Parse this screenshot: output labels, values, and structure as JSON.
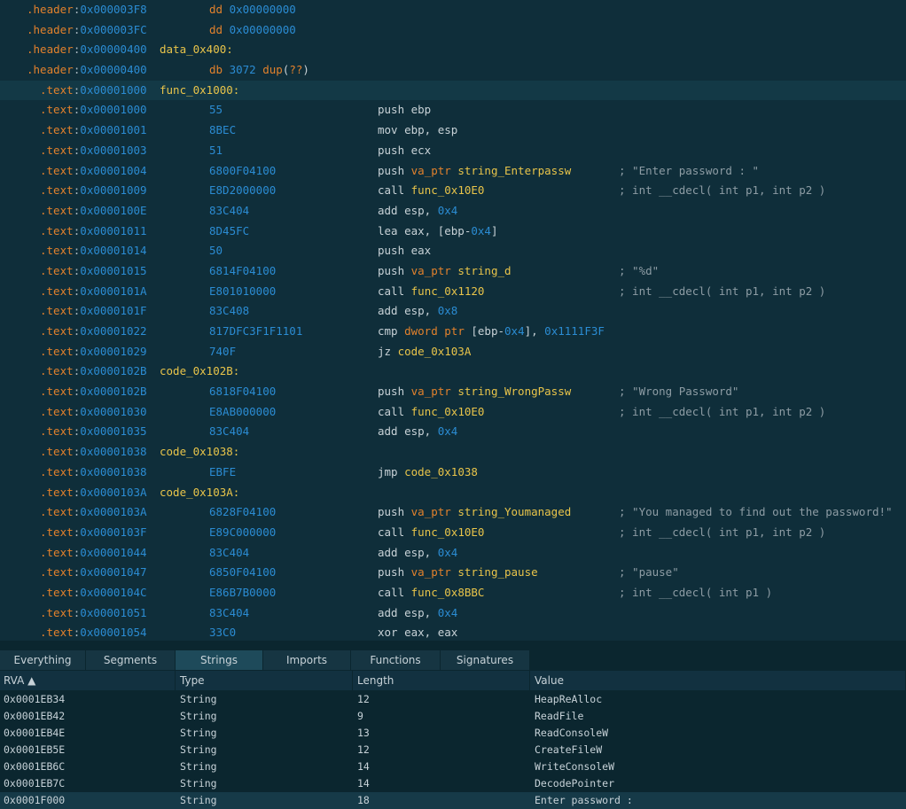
{
  "disassembly": [
    {
      "seg": ".header",
      "addr": "0x000003F8",
      "label": "",
      "bytes": "",
      "parts": [
        [
          "kw",
          "dd "
        ],
        [
          "num",
          "0x00000000"
        ]
      ],
      "comment": "",
      "indent": 0
    },
    {
      "seg": ".header",
      "addr": "0x000003FC",
      "label": "",
      "bytes": "",
      "parts": [
        [
          "kw",
          "dd "
        ],
        [
          "num",
          "0x00000000"
        ]
      ],
      "comment": "",
      "indent": 0
    },
    {
      "seg": ".header",
      "addr": "0x00000400",
      "label": "data_0x400:",
      "bytes": "",
      "parts": [],
      "comment": "",
      "indent": 0
    },
    {
      "seg": ".header",
      "addr": "0x00000400",
      "label": "",
      "bytes": "",
      "parts": [
        [
          "kw",
          "db "
        ],
        [
          "num",
          "3072 "
        ],
        [
          "kw",
          "dup"
        ],
        [
          "op",
          "("
        ],
        [
          "kw",
          "??"
        ],
        [
          "op",
          ")"
        ]
      ],
      "comment": "",
      "indent": 0
    },
    {
      "seg": ".text",
      "addr": "0x00001000",
      "label": "func_0x1000:",
      "bytes": "",
      "parts": [],
      "comment": "",
      "indent": 1,
      "highlight": true
    },
    {
      "seg": ".text",
      "addr": "0x00001000",
      "label": "",
      "bytes": "55",
      "parts": [
        [
          "op",
          "push ebp"
        ]
      ],
      "comment": "",
      "indent": 1
    },
    {
      "seg": ".text",
      "addr": "0x00001001",
      "label": "",
      "bytes": "8BEC",
      "parts": [
        [
          "op",
          "mov ebp, esp"
        ]
      ],
      "comment": "",
      "indent": 1
    },
    {
      "seg": ".text",
      "addr": "0x00001003",
      "label": "",
      "bytes": "51",
      "parts": [
        [
          "op",
          "push ecx"
        ]
      ],
      "comment": "",
      "indent": 1
    },
    {
      "seg": ".text",
      "addr": "0x00001004",
      "label": "",
      "bytes": "6800F04100",
      "parts": [
        [
          "op",
          "push "
        ],
        [
          "kw",
          "va_ptr "
        ],
        [
          "lbl",
          "string_Enterpassw"
        ]
      ],
      "comment": "; \"Enter password : \"",
      "indent": 1
    },
    {
      "seg": ".text",
      "addr": "0x00001009",
      "label": "",
      "bytes": "E8D2000000",
      "parts": [
        [
          "op",
          "call "
        ],
        [
          "lbl",
          "func_0x10E0"
        ]
      ],
      "comment": "; int __cdecl( int p1, int p2 )",
      "indent": 1
    },
    {
      "seg": ".text",
      "addr": "0x0000100E",
      "label": "",
      "bytes": "83C404",
      "parts": [
        [
          "op",
          "add esp, "
        ],
        [
          "num",
          "0x4"
        ]
      ],
      "comment": "",
      "indent": 1
    },
    {
      "seg": ".text",
      "addr": "0x00001011",
      "label": "",
      "bytes": "8D45FC",
      "parts": [
        [
          "op",
          "lea eax, [ebp-"
        ],
        [
          "num",
          "0x4"
        ],
        [
          "op",
          "]"
        ]
      ],
      "comment": "",
      "indent": 1
    },
    {
      "seg": ".text",
      "addr": "0x00001014",
      "label": "",
      "bytes": "50",
      "parts": [
        [
          "op",
          "push eax"
        ]
      ],
      "comment": "",
      "indent": 1
    },
    {
      "seg": ".text",
      "addr": "0x00001015",
      "label": "",
      "bytes": "6814F04100",
      "parts": [
        [
          "op",
          "push "
        ],
        [
          "kw",
          "va_ptr "
        ],
        [
          "lbl",
          "string_d"
        ]
      ],
      "comment": "; \"%d\"",
      "indent": 1
    },
    {
      "seg": ".text",
      "addr": "0x0000101A",
      "label": "",
      "bytes": "E801010000",
      "parts": [
        [
          "op",
          "call "
        ],
        [
          "lbl",
          "func_0x1120"
        ]
      ],
      "comment": "; int __cdecl( int p1, int p2 )",
      "indent": 1
    },
    {
      "seg": ".text",
      "addr": "0x0000101F",
      "label": "",
      "bytes": "83C408",
      "parts": [
        [
          "op",
          "add esp, "
        ],
        [
          "num",
          "0x8"
        ]
      ],
      "comment": "",
      "indent": 1
    },
    {
      "seg": ".text",
      "addr": "0x00001022",
      "label": "",
      "bytes": "817DFC3F1F1101",
      "parts": [
        [
          "op",
          "cmp "
        ],
        [
          "kw",
          "dword ptr "
        ],
        [
          "op",
          "[ebp-"
        ],
        [
          "num",
          "0x4"
        ],
        [
          "op",
          "], "
        ],
        [
          "num",
          "0x1111F3F"
        ]
      ],
      "comment": "",
      "indent": 1
    },
    {
      "seg": ".text",
      "addr": "0x00001029",
      "label": "",
      "bytes": "740F",
      "parts": [
        [
          "op",
          "jz "
        ],
        [
          "lbl",
          "code_0x103A"
        ]
      ],
      "comment": "",
      "indent": 1
    },
    {
      "seg": ".text",
      "addr": "0x0000102B",
      "label": "code_0x102B:",
      "bytes": "",
      "parts": [],
      "comment": "",
      "indent": 1
    },
    {
      "seg": ".text",
      "addr": "0x0000102B",
      "label": "",
      "bytes": "6818F04100",
      "parts": [
        [
          "op",
          "push "
        ],
        [
          "kw",
          "va_ptr "
        ],
        [
          "lbl",
          "string_WrongPassw"
        ]
      ],
      "comment": "; \"Wrong Password\"",
      "indent": 1
    },
    {
      "seg": ".text",
      "addr": "0x00001030",
      "label": "",
      "bytes": "E8AB000000",
      "parts": [
        [
          "op",
          "call "
        ],
        [
          "lbl",
          "func_0x10E0"
        ]
      ],
      "comment": "; int __cdecl( int p1, int p2 )",
      "indent": 1
    },
    {
      "seg": ".text",
      "addr": "0x00001035",
      "label": "",
      "bytes": "83C404",
      "parts": [
        [
          "op",
          "add esp, "
        ],
        [
          "num",
          "0x4"
        ]
      ],
      "comment": "",
      "indent": 1
    },
    {
      "seg": ".text",
      "addr": "0x00001038",
      "label": "code_0x1038:",
      "bytes": "",
      "parts": [],
      "comment": "",
      "indent": 1
    },
    {
      "seg": ".text",
      "addr": "0x00001038",
      "label": "",
      "bytes": "EBFE",
      "parts": [
        [
          "op",
          "jmp "
        ],
        [
          "lbl",
          "code_0x1038"
        ]
      ],
      "comment": "",
      "indent": 1
    },
    {
      "seg": ".text",
      "addr": "0x0000103A",
      "label": "code_0x103A:",
      "bytes": "",
      "parts": [],
      "comment": "",
      "indent": 1
    },
    {
      "seg": ".text",
      "addr": "0x0000103A",
      "label": "",
      "bytes": "6828F04100",
      "parts": [
        [
          "op",
          "push "
        ],
        [
          "kw",
          "va_ptr "
        ],
        [
          "lbl",
          "string_Youmanaged"
        ]
      ],
      "comment": "; \"You managed to find out the password!\"",
      "indent": 1
    },
    {
      "seg": ".text",
      "addr": "0x0000103F",
      "label": "",
      "bytes": "E89C000000",
      "parts": [
        [
          "op",
          "call "
        ],
        [
          "lbl",
          "func_0x10E0"
        ]
      ],
      "comment": "; int __cdecl( int p1, int p2 )",
      "indent": 1
    },
    {
      "seg": ".text",
      "addr": "0x00001044",
      "label": "",
      "bytes": "83C404",
      "parts": [
        [
          "op",
          "add esp, "
        ],
        [
          "num",
          "0x4"
        ]
      ],
      "comment": "",
      "indent": 1
    },
    {
      "seg": ".text",
      "addr": "0x00001047",
      "label": "",
      "bytes": "6850F04100",
      "parts": [
        [
          "op",
          "push "
        ],
        [
          "kw",
          "va_ptr "
        ],
        [
          "lbl",
          "string_pause"
        ]
      ],
      "comment": "; \"pause\"",
      "indent": 1
    },
    {
      "seg": ".text",
      "addr": "0x0000104C",
      "label": "",
      "bytes": "E86B7B0000",
      "parts": [
        [
          "op",
          "call "
        ],
        [
          "lbl",
          "func_0x8BBC"
        ]
      ],
      "comment": "; int __cdecl( int p1 )",
      "indent": 1
    },
    {
      "seg": ".text",
      "addr": "0x00001051",
      "label": "",
      "bytes": "83C404",
      "parts": [
        [
          "op",
          "add esp, "
        ],
        [
          "num",
          "0x4"
        ]
      ],
      "comment": "",
      "indent": 1
    },
    {
      "seg": ".text",
      "addr": "0x00001054",
      "label": "",
      "bytes": "33C0",
      "parts": [
        [
          "op",
          "xor eax, eax"
        ]
      ],
      "comment": "",
      "indent": 1
    }
  ],
  "tabs": [
    {
      "label": "Everything",
      "active": false
    },
    {
      "label": "Segments",
      "active": false
    },
    {
      "label": "Strings",
      "active": true
    },
    {
      "label": "Imports",
      "active": false
    },
    {
      "label": "Functions",
      "active": false
    },
    {
      "label": "Signatures",
      "active": false
    }
  ],
  "columns": [
    "RVA ▲",
    "Type",
    "Length",
    "Value"
  ],
  "strings": [
    {
      "rva": "0x0001EB34",
      "type": "String",
      "length": "12",
      "value": "HeapReAlloc"
    },
    {
      "rva": "0x0001EB42",
      "type": "String",
      "length": "9",
      "value": "ReadFile"
    },
    {
      "rva": "0x0001EB4E",
      "type": "String",
      "length": "13",
      "value": "ReadConsoleW"
    },
    {
      "rva": "0x0001EB5E",
      "type": "String",
      "length": "12",
      "value": "CreateFileW"
    },
    {
      "rva": "0x0001EB6C",
      "type": "String",
      "length": "14",
      "value": "WriteConsoleW"
    },
    {
      "rva": "0x0001EB7C",
      "type": "String",
      "length": "14",
      "value": "DecodePointer"
    },
    {
      "rva": "0x0001F000",
      "type": "String",
      "length": "18",
      "value": "Enter password :",
      "selected": true
    }
  ]
}
